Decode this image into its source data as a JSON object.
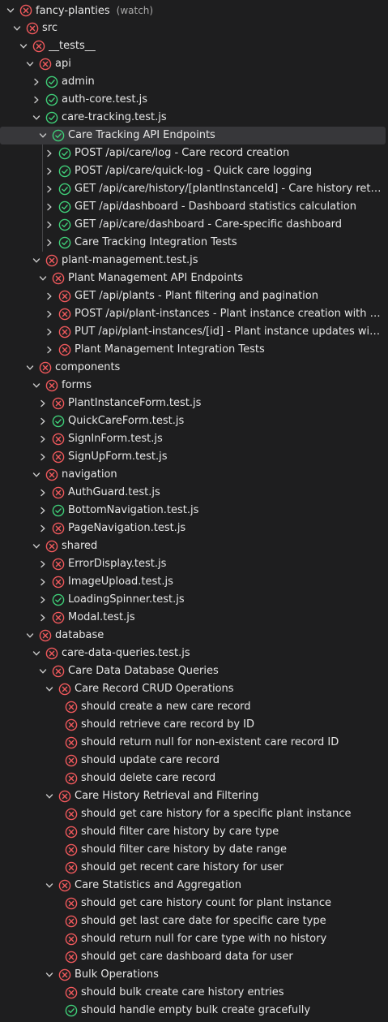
{
  "colors": {
    "background": "#1e1e1f",
    "text": "#e6e6e6",
    "muted": "#a8a8a8",
    "fail": "#f1595c",
    "pass": "#3fcf78",
    "chevron": "#c9c9c9",
    "selected": "#37373a"
  },
  "tree": {
    "rows": [
      {
        "label": "fancy-planties",
        "suffix": "(watch)",
        "status": "fail",
        "level": 0,
        "chevron": "down"
      },
      {
        "label": "src",
        "status": "fail",
        "level": 1,
        "chevron": "down"
      },
      {
        "label": "__tests__",
        "status": "fail",
        "level": 2,
        "chevron": "down"
      },
      {
        "label": "api",
        "status": "fail",
        "level": 3,
        "chevron": "down"
      },
      {
        "label": "admin",
        "status": "pass",
        "level": 4,
        "chevron": "right"
      },
      {
        "label": "auth-core.test.js",
        "status": "pass",
        "level": 4,
        "chevron": "right"
      },
      {
        "label": "care-tracking.test.js",
        "status": "pass",
        "level": 4,
        "chevron": "down"
      },
      {
        "label": "Care Tracking API Endpoints",
        "status": "pass",
        "level": 5,
        "chevron": "down",
        "selected": true
      },
      {
        "label": "POST /api/care/log - Care record creation",
        "status": "pass",
        "level": 6,
        "chevron": "right"
      },
      {
        "label": "POST /api/care/quick-log - Quick care logging",
        "status": "pass",
        "level": 6,
        "chevron": "right"
      },
      {
        "label": "GET /api/care/history/[plantInstanceId] - Care history retrieval...",
        "status": "pass",
        "level": 6,
        "chevron": "right"
      },
      {
        "label": "GET /api/dashboard - Dashboard statistics calculation",
        "status": "pass",
        "level": 6,
        "chevron": "right"
      },
      {
        "label": "GET /api/care/dashboard - Care-specific dashboard",
        "status": "pass",
        "level": 6,
        "chevron": "right"
      },
      {
        "label": "Care Tracking Integration Tests",
        "status": "pass",
        "level": 6,
        "chevron": "right"
      },
      {
        "label": "plant-management.test.js",
        "status": "fail",
        "level": 4,
        "chevron": "down"
      },
      {
        "label": "Plant Management API Endpoints",
        "status": "fail",
        "level": 5,
        "chevron": "down"
      },
      {
        "label": "GET /api/plants - Plant filtering and pagination",
        "status": "fail",
        "level": 6,
        "chevron": "right"
      },
      {
        "label": "POST /api/plant-instances - Plant instance creation with data ...",
        "status": "fail",
        "level": 6,
        "chevron": "right"
      },
      {
        "label": "PUT /api/plant-instances/[id] - Plant instance updates with au...",
        "status": "fail",
        "level": 6,
        "chevron": "right"
      },
      {
        "label": "Plant Management Integration Tests",
        "status": "fail",
        "level": 6,
        "chevron": "right"
      },
      {
        "label": "components",
        "status": "fail",
        "level": 3,
        "chevron": "down"
      },
      {
        "label": "forms",
        "status": "fail",
        "level": 4,
        "chevron": "down"
      },
      {
        "label": "PlantInstanceForm.test.js",
        "status": "fail",
        "level": 5,
        "chevron": "right"
      },
      {
        "label": "QuickCareForm.test.js",
        "status": "pass",
        "level": 5,
        "chevron": "right"
      },
      {
        "label": "SignInForm.test.js",
        "status": "fail",
        "level": 5,
        "chevron": "right"
      },
      {
        "label": "SignUpForm.test.js",
        "status": "fail",
        "level": 5,
        "chevron": "right"
      },
      {
        "label": "navigation",
        "status": "fail",
        "level": 4,
        "chevron": "down"
      },
      {
        "label": "AuthGuard.test.js",
        "status": "fail",
        "level": 5,
        "chevron": "right"
      },
      {
        "label": "BottomNavigation.test.js",
        "status": "pass",
        "level": 5,
        "chevron": "right"
      },
      {
        "label": "PageNavigation.test.js",
        "status": "fail",
        "level": 5,
        "chevron": "right"
      },
      {
        "label": "shared",
        "status": "fail",
        "level": 4,
        "chevron": "down"
      },
      {
        "label": "ErrorDisplay.test.js",
        "status": "fail",
        "level": 5,
        "chevron": "right"
      },
      {
        "label": "ImageUpload.test.js",
        "status": "fail",
        "level": 5,
        "chevron": "right"
      },
      {
        "label": "LoadingSpinner.test.js",
        "status": "pass",
        "level": 5,
        "chevron": "right"
      },
      {
        "label": "Modal.test.js",
        "status": "fail",
        "level": 5,
        "chevron": "right"
      },
      {
        "label": "database",
        "status": "fail",
        "level": 3,
        "chevron": "down"
      },
      {
        "label": "care-data-queries.test.js",
        "status": "fail",
        "level": 4,
        "chevron": "down"
      },
      {
        "label": "Care Data Database Queries",
        "status": "fail",
        "level": 5,
        "chevron": "down"
      },
      {
        "label": "Care Record CRUD Operations",
        "status": "fail",
        "level": 6,
        "chevron": "down"
      },
      {
        "label": "should create a new care record",
        "status": "fail",
        "level": 7,
        "chevron": "none"
      },
      {
        "label": "should retrieve care record by ID",
        "status": "fail",
        "level": 7,
        "chevron": "none"
      },
      {
        "label": "should return null for non-existent care record ID",
        "status": "fail",
        "level": 7,
        "chevron": "none"
      },
      {
        "label": "should update care record",
        "status": "fail",
        "level": 7,
        "chevron": "none"
      },
      {
        "label": "should delete care record",
        "status": "fail",
        "level": 7,
        "chevron": "none"
      },
      {
        "label": "Care History Retrieval and Filtering",
        "status": "fail",
        "level": 6,
        "chevron": "down"
      },
      {
        "label": "should get care history for a specific plant instance",
        "status": "fail",
        "level": 7,
        "chevron": "none"
      },
      {
        "label": "should filter care history by care type",
        "status": "fail",
        "level": 7,
        "chevron": "none"
      },
      {
        "label": "should filter care history by date range",
        "status": "fail",
        "level": 7,
        "chevron": "none"
      },
      {
        "label": "should get recent care history for user",
        "status": "fail",
        "level": 7,
        "chevron": "none"
      },
      {
        "label": "Care Statistics and Aggregation",
        "status": "fail",
        "level": 6,
        "chevron": "down"
      },
      {
        "label": "should get care history count for plant instance",
        "status": "fail",
        "level": 7,
        "chevron": "none"
      },
      {
        "label": "should get last care date for specific care type",
        "status": "fail",
        "level": 7,
        "chevron": "none"
      },
      {
        "label": "should return null for care type with no history",
        "status": "fail",
        "level": 7,
        "chevron": "none"
      },
      {
        "label": "should get care dashboard data for user",
        "status": "fail",
        "level": 7,
        "chevron": "none"
      },
      {
        "label": "Bulk Operations",
        "status": "fail",
        "level": 6,
        "chevron": "down"
      },
      {
        "label": "should bulk create care history entries",
        "status": "fail",
        "level": 7,
        "chevron": "none"
      },
      {
        "label": "should handle empty bulk create gracefully",
        "status": "pass",
        "level": 7,
        "chevron": "none"
      }
    ]
  }
}
